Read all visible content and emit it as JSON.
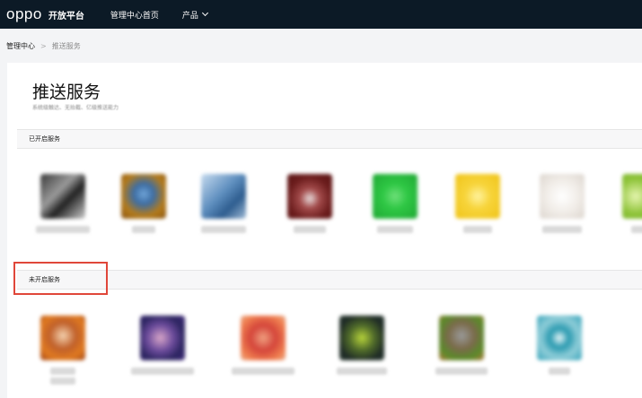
{
  "header": {
    "logo": "oppo",
    "platform": "开放平台",
    "nav": [
      {
        "label": "管理中心首页",
        "has_dropdown": false
      },
      {
        "label": "产品",
        "has_dropdown": true
      }
    ]
  },
  "breadcrumb": {
    "home": "管理中心",
    "separator": ">",
    "current": "推送服务"
  },
  "page": {
    "title": "推送服务",
    "subtitle": "系统级触达、无抬截、亿级推送能力"
  },
  "sections": {
    "open": {
      "label": "已开启服务"
    },
    "closed": {
      "label": "未开启服务"
    }
  },
  "colors": {
    "topbar": "#0c1a26",
    "highlight": "#e0473a"
  },
  "apps_open": [
    {
      "icon": "app-icon-blurred"
    },
    {
      "icon": "app-icon-blurred"
    },
    {
      "icon": "app-icon-blurred"
    },
    {
      "icon": "app-icon-blurred"
    },
    {
      "icon": "app-icon-blurred"
    },
    {
      "icon": "app-icon-blurred"
    },
    {
      "icon": "app-icon-blurred"
    },
    {
      "icon": "app-icon-blurred"
    }
  ],
  "apps_closed": [
    {
      "icon": "app-icon-blurred"
    },
    {
      "icon": "app-icon-blurred"
    },
    {
      "icon": "app-icon-blurred"
    },
    {
      "icon": "app-icon-blurred"
    },
    {
      "icon": "app-icon-blurred"
    },
    {
      "icon": "app-icon-blurred"
    }
  ]
}
